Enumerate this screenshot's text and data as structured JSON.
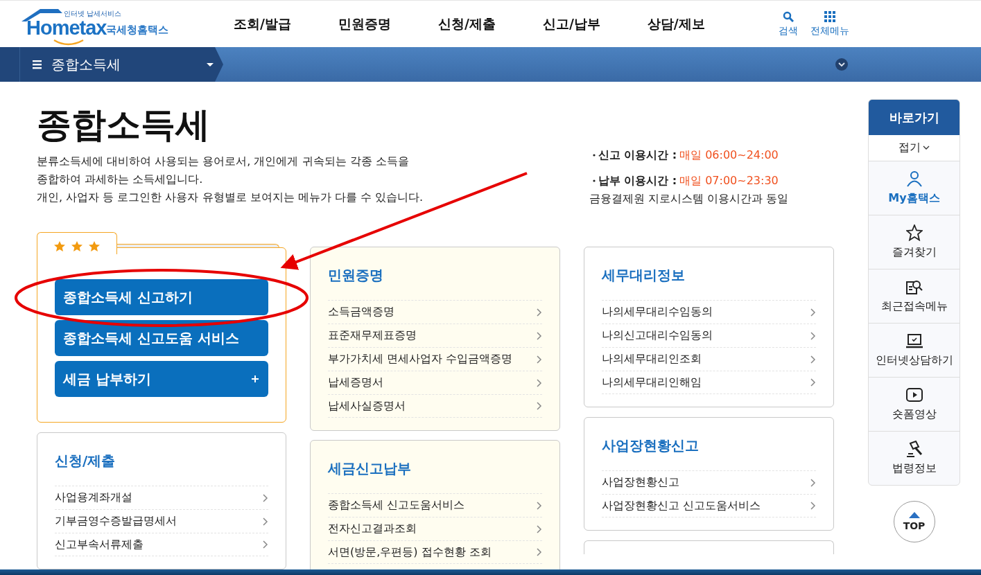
{
  "header": {
    "logo_tagline": "인터넷 납세서비스",
    "logo_wordmark": "Hometax",
    "logo_korean": "국세청홈택스",
    "nav": [
      {
        "label": "조회/발급"
      },
      {
        "label": "민원증명"
      },
      {
        "label": "신청/제출"
      },
      {
        "label": "신고/납부"
      },
      {
        "label": "상담/제보"
      }
    ],
    "tools": [
      {
        "label": "검색",
        "kind": "search"
      },
      {
        "label": "전체메뉴",
        "kind": "grid"
      }
    ]
  },
  "menubar": {
    "current": "종합소득세"
  },
  "intro": {
    "title": "종합소득세",
    "description": [
      "분류소득세에 대비하여 사용되는 용어로서, 개인에게 귀속되는 각종 소득을",
      "종합하여 과세하는 소득세입니다.",
      "개인, 사업자 등 로그인한 사용자 유형별로 보여지는 메뉴가 다를 수 있습니다."
    ],
    "hours": [
      {
        "label": "신고 이용시간 :",
        "value": "매일 06:00~24:00"
      },
      {
        "label": "납부 이용시간 :",
        "value": "매일 07:00~23:30",
        "note": "금융결제원 지로시스템 이용시간과 동일"
      }
    ]
  },
  "favorites": {
    "stars": 3,
    "buttons": [
      {
        "label": "종합소득세 신고하기",
        "expandable": false
      },
      {
        "label": "종합소득세 신고도움 서비스",
        "expandable": false
      },
      {
        "label": "세금 납부하기",
        "expandable": true
      }
    ]
  },
  "columns": [
    {
      "cards": [
        {
          "title": "신청/제출",
          "tinted": false,
          "items": [
            "사업용계좌개설",
            "기부금영수증발급명세서",
            "신고부속서류제출"
          ]
        }
      ]
    },
    {
      "cards": [
        {
          "title": "민원증명",
          "tinted": true,
          "items": [
            "소득금액증명",
            "표준재무제표증명",
            "부가가치세 면세사업자 수입금액증명",
            "납세증명서",
            "납세사실증명서"
          ]
        },
        {
          "title": "세금신고납부",
          "tinted": true,
          "items": [
            "종합소득세 신고도움서비스",
            "전자신고결과조회",
            "서면(방문,우편등) 접수현황 조회"
          ]
        }
      ]
    },
    {
      "cards": [
        {
          "title": "세무대리정보",
          "tinted": false,
          "items": [
            "나의세무대리수임동의",
            "나의신고대리수임동의",
            "나의세무대리인조회",
            "나의세무대리인해임"
          ]
        },
        {
          "title": "사업장현황신고",
          "tinted": false,
          "items": [
            "사업장현황신고",
            "사업장현황신고 신고도움서비스"
          ]
        },
        {
          "tinted": false
        }
      ]
    }
  ],
  "sidebar": {
    "title": "바로가기",
    "collapse": "접기",
    "items": [
      {
        "label": "My홈택스",
        "kind": "user",
        "selected": true
      },
      {
        "label": "즐겨찾기",
        "kind": "star",
        "selected": false
      },
      {
        "label": "최근접속메뉴",
        "kind": "recent",
        "selected": false
      },
      {
        "label": "인터넷상담하기",
        "kind": "laptop",
        "selected": false
      },
      {
        "label": "숏폼영상",
        "kind": "video",
        "selected": false
      },
      {
        "label": "법령정보",
        "kind": "gavel",
        "selected": false
      }
    ],
    "top": "TOP"
  }
}
